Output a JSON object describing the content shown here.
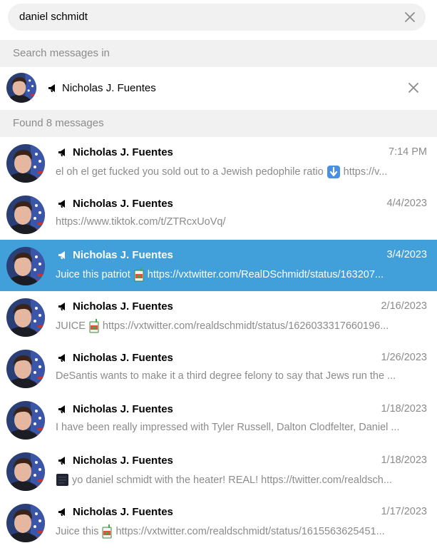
{
  "search": {
    "query": "daniel schmidt"
  },
  "scope": {
    "header": "Search messages in",
    "chat_name": "Nicholas J. Fuentes"
  },
  "results_header": "Found 8 messages",
  "results": [
    {
      "name": "Nicholas J. Fuentes",
      "date": "7:14 PM",
      "text": "el oh el get fucked you sold out to a Jewish pedophile  ratio",
      "emoji": "down-arrow-icon",
      "text2": "https://v..."
    },
    {
      "name": "Nicholas J. Fuentes",
      "date": "4/4/2023",
      "text": "https://www.tiktok.com/t/ZTRcxUoVq/"
    },
    {
      "name": "Nicholas J. Fuentes",
      "date": "3/4/2023",
      "text": "Juice this patriot",
      "emoji": "juice-box-icon",
      "text2": " https://vxtwitter.com/RealDSchmidt/status/163207...",
      "active": true
    },
    {
      "name": "Nicholas J. Fuentes",
      "date": "2/16/2023",
      "text": "JUICE",
      "emoji": "juice-box-icon",
      "text2": " https://vxtwitter.com/realdschmidt/status/1626033317660196..."
    },
    {
      "name": "Nicholas J. Fuentes",
      "date": "1/26/2023",
      "text": "DeSantis wants to make it a third degree felony to say that Jews run the ..."
    },
    {
      "name": "Nicholas J. Fuentes",
      "date": "1/18/2023",
      "text": "I have been really impressed with Tyler Russell, Dalton Clodfelter, Daniel ..."
    },
    {
      "name": "Nicholas J. Fuentes",
      "date": "1/18/2023",
      "lead_emoji": "dark-square-icon",
      "text": "yo daniel schmidt with the heater! REAL! https://twitter.com/realdsch..."
    },
    {
      "name": "Nicholas J. Fuentes",
      "date": "1/17/2023",
      "text": "Juice this",
      "emoji": "juice-box-icon",
      "text2": " https://vxtwitter.com/realdschmidt/status/1615563625451..."
    }
  ],
  "colors": {
    "active_row": "#419fd9",
    "muted_text": "#8b8b8b",
    "header_bg": "#f1f1f1"
  }
}
